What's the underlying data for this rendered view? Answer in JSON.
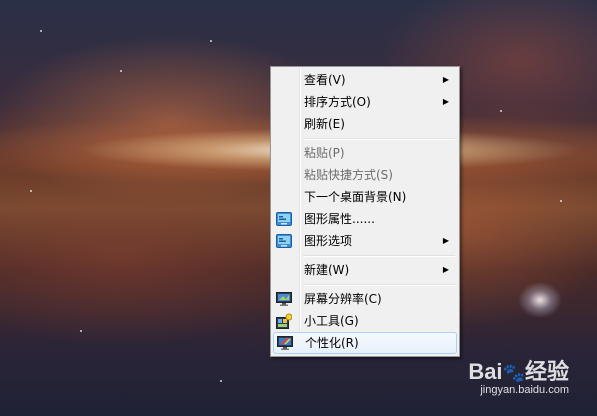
{
  "menu": {
    "items": [
      {
        "label": "查看(V)",
        "submenu": true,
        "disabled": false
      },
      {
        "label": "排序方式(O)",
        "submenu": true,
        "disabled": false
      },
      {
        "label": "刷新(E)",
        "submenu": false,
        "disabled": false
      },
      {
        "label": "粘贴(P)",
        "submenu": false,
        "disabled": true
      },
      {
        "label": "粘贴快捷方式(S)",
        "submenu": false,
        "disabled": true
      },
      {
        "label": "下一个桌面背景(N)",
        "submenu": false,
        "disabled": false
      },
      {
        "label": "图形属性......",
        "submenu": false,
        "disabled": false,
        "icon": "graphics-properties-icon"
      },
      {
        "label": "图形选项",
        "submenu": true,
        "disabled": false,
        "icon": "graphics-options-icon"
      },
      {
        "label": "新建(W)",
        "submenu": true,
        "disabled": false
      },
      {
        "label": "屏幕分辨率(C)",
        "submenu": false,
        "disabled": false,
        "icon": "screen-resolution-icon"
      },
      {
        "label": "小工具(G)",
        "submenu": false,
        "disabled": false,
        "icon": "gadgets-icon"
      },
      {
        "label": "个性化(R)",
        "submenu": false,
        "disabled": false,
        "highlighted": true,
        "icon": "personalize-icon"
      }
    ],
    "submenu_arrow": "▶"
  },
  "watermark": {
    "brand": "Bai",
    "brand_suffix": "经验",
    "url": "jingyan.baidu.com"
  }
}
